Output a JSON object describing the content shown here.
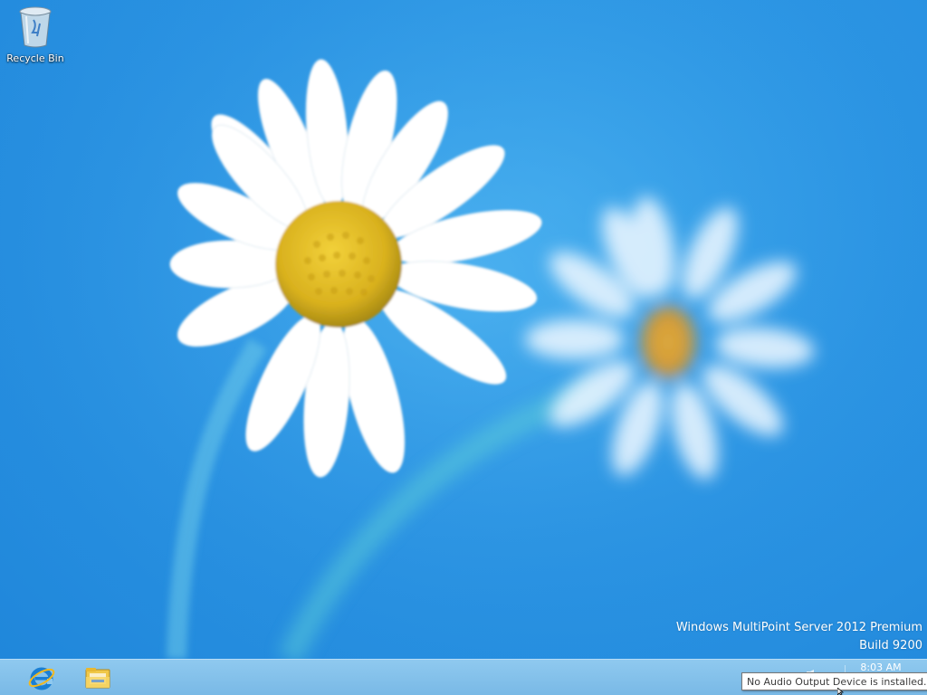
{
  "desktop": {
    "icons": [
      {
        "label": "Recycle Bin",
        "icon": "recycle-bin-icon"
      }
    ],
    "wallpaper": "daisy-flowers-wallpaper",
    "background_color": "#2b94e3"
  },
  "watermark": {
    "line1": "Windows MultiPoint Server 2012 Premium",
    "line2": "Build 9200"
  },
  "taskbar": {
    "background_color": "#86c2ec",
    "pinned": [
      {
        "icon": "internet-explorer-icon"
      },
      {
        "icon": "file-explorer-icon"
      }
    ],
    "clock": {
      "time": "8:03 AM"
    }
  },
  "tooltip": {
    "text": "No Audio Output Device is installed."
  }
}
